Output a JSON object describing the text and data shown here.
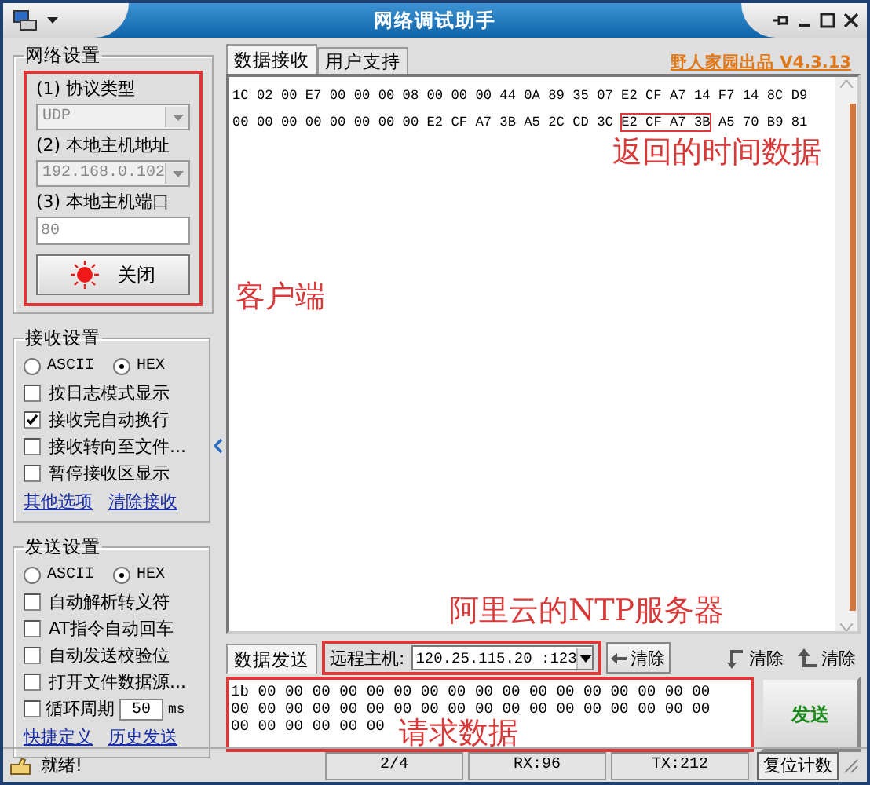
{
  "window": {
    "title": "网络调试助手"
  },
  "network_settings": {
    "title": "网络设置",
    "protocol_label": "(1) 协议类型",
    "protocol": "UDP",
    "host_label": "(2) 本地主机地址",
    "host": "192.168.0.102",
    "port_label": "(3) 本地主机端口",
    "port": "80",
    "connect_button": "关闭"
  },
  "receive_settings": {
    "title": "接收设置",
    "formats": [
      {
        "label": "ASCII",
        "selected": false
      },
      {
        "label": "HEX",
        "selected": true
      }
    ],
    "options": [
      {
        "label": "按日志模式显示",
        "checked": false
      },
      {
        "label": "接收完自动换行",
        "checked": true
      },
      {
        "label": "接收转向至文件...",
        "checked": false
      },
      {
        "label": "暂停接收区显示",
        "checked": false
      }
    ],
    "links": [
      "其他选项",
      "清除接收"
    ]
  },
  "send_settings": {
    "title": "发送设置",
    "formats": [
      {
        "label": "ASCII",
        "selected": false
      },
      {
        "label": "HEX",
        "selected": true
      }
    ],
    "options": [
      {
        "label": "自动解析转义符",
        "checked": false
      },
      {
        "label": "AT指令自动回车",
        "checked": false
      },
      {
        "label": "自动发送校验位",
        "checked": false
      },
      {
        "label": "打开文件数据源...",
        "checked": false
      }
    ],
    "cycle": {
      "label": "循环周期",
      "checked": false,
      "value": "50",
      "unit": "ms"
    },
    "links": [
      "快捷定义",
      "历史发送"
    ]
  },
  "receive_tabs": [
    {
      "label": "数据接收",
      "selected": true
    },
    {
      "label": "用户支持",
      "selected": false
    }
  ],
  "brand": "野人家园出品 V4.3.13",
  "received_lines": [
    {
      "segments": [
        {
          "text": "1C 02 00 E7 00 00 00 08 00 00 00 44 0A 89 35 07 E2 CF A7 14 F7 14 8C D9",
          "highlighted": false
        }
      ]
    },
    {
      "segments": [
        {
          "text": "00 00 00 00 00 00 00 00 E2 CF A7 3B A5 2C CD 3C",
          "highlighted": false
        },
        {
          "text": "E2 CF A7 3B",
          "highlighted": true
        },
        {
          "text": "A5 70 B9 81",
          "highlighted": false
        }
      ]
    }
  ],
  "send_tab": {
    "label": "数据发送",
    "selected": true
  },
  "remote_host": {
    "label": "远程主机:",
    "value": "120.25.115.20 :123"
  },
  "clear_buttons": [
    {
      "label": "清除",
      "kind": "left"
    },
    {
      "label": "清除",
      "kind": "return"
    },
    {
      "label": "清除",
      "kind": "up"
    }
  ],
  "send_lines": [
    "1b 00 00 00 00 00 00 00 00 00 00 00 00 00 00 00 00 00",
    "00 00 00 00 00 00 00 00 00 00 00 00 00 00 00 00 00 00",
    "00 00 00 00 00 00"
  ],
  "send_button": "发送",
  "status_bar": {
    "message": "就绪!",
    "counter": "2/4",
    "rx": "RX:96",
    "tx": "TX:212",
    "reset_button": "复位计数"
  },
  "annotations": [
    {
      "text": "客户端"
    },
    {
      "text": "返回的时间数据"
    },
    {
      "text": "阿里云的NTP服务器"
    },
    {
      "text": "请求数据"
    }
  ]
}
